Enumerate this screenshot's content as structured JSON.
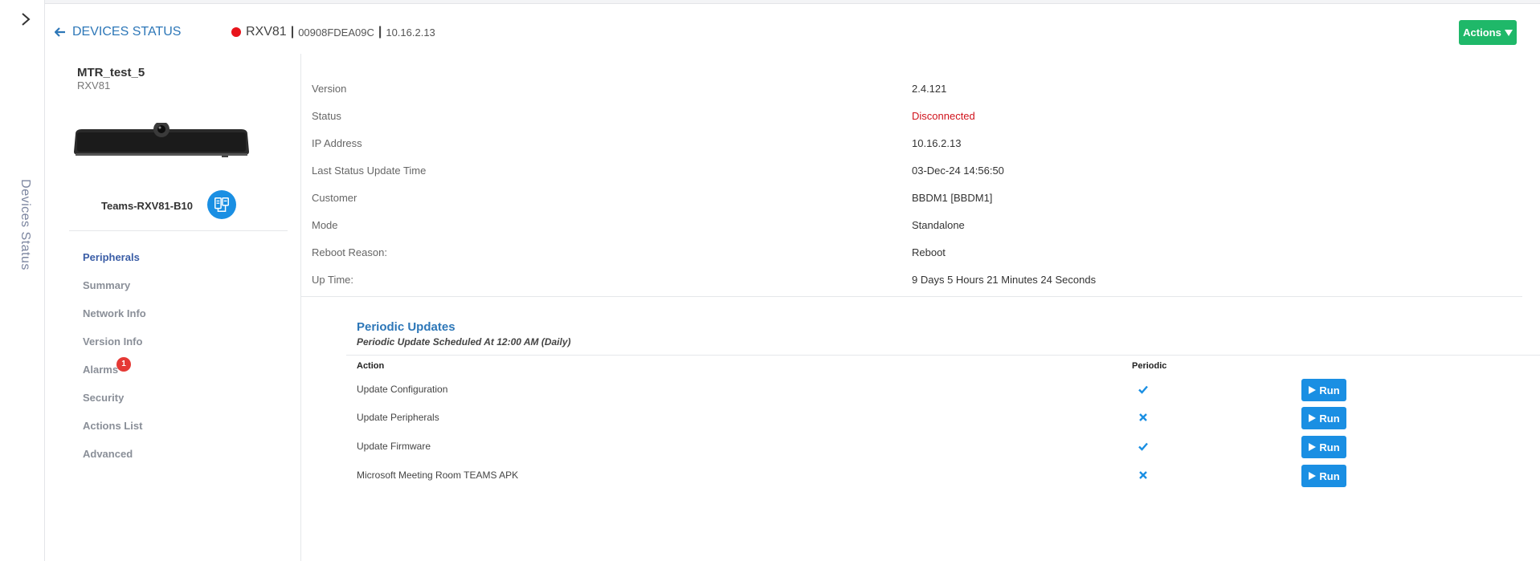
{
  "rail": {
    "toggle_icon": "chevron-right-icon",
    "label": "Devices Status"
  },
  "header": {
    "back_label": "DEVICES STATUS",
    "device_model": "RXV81",
    "mac": "00908FDEA09C",
    "ip": "10.16.2.13",
    "status_color": "#e8141b",
    "actions_label": "Actions"
  },
  "sidebar": {
    "device_name": "MTR_test_5",
    "device_model": "RXV81",
    "room_name": "Teams-RXV81-B10",
    "nav": [
      {
        "label": "Peripherals",
        "active": true
      },
      {
        "label": "Summary"
      },
      {
        "label": "Network Info"
      },
      {
        "label": "Version Info"
      },
      {
        "label": "Alarms",
        "badge": "1"
      },
      {
        "label": "Security"
      },
      {
        "label": "Actions List"
      },
      {
        "label": "Advanced"
      }
    ]
  },
  "info": [
    {
      "label": "Version",
      "value": "2.4.121"
    },
    {
      "label": "Status",
      "value": "Disconnected"
    },
    {
      "label": "IP Address",
      "value": "10.16.2.13"
    },
    {
      "label": "Last Status Update Time",
      "value": "03-Dec-24 14:56:50"
    },
    {
      "label": "Customer",
      "value": "BBDM1 [BBDM1]"
    },
    {
      "label": "Mode",
      "value": "Standalone"
    },
    {
      "label": "Reboot Reason:",
      "value": "Reboot"
    },
    {
      "label": "Up Time:",
      "value": "9 Days 5 Hours 21 Minutes 24 Seconds"
    }
  ],
  "periodic": {
    "title": "Periodic Updates",
    "schedule": "Periodic Update Scheduled At 12:00 AM (Daily)",
    "col_action": "Action",
    "col_periodic": "Periodic",
    "run_label": "Run",
    "rows": [
      {
        "action": "Update Configuration",
        "periodic": "check-icon"
      },
      {
        "action": "Update Peripherals",
        "periodic": "x-icon"
      },
      {
        "action": "Update Firmware",
        "periodic": "check-icon"
      },
      {
        "action": "Microsoft Meeting Room TEAMS APK",
        "periodic": "x-icon"
      }
    ]
  },
  "colors": {
    "accent_blue": "#1a8fe3",
    "actions_green": "#1fb869",
    "disconnected_red": "#d0121b"
  }
}
